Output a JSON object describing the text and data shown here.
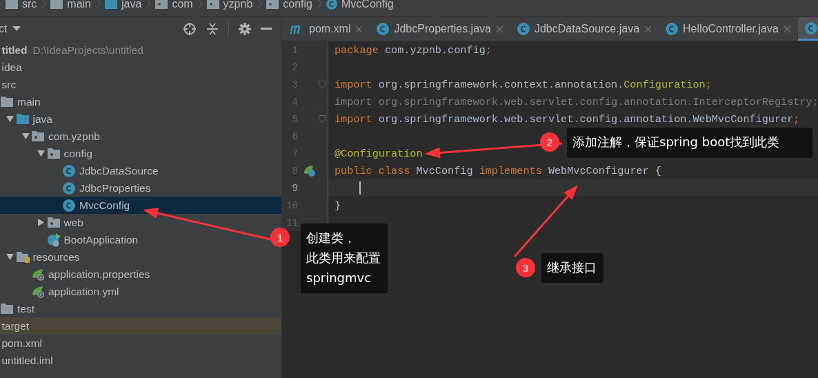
{
  "breadcrumb": [
    {
      "label": "src",
      "kind": "folder"
    },
    {
      "label": "main",
      "kind": "folder"
    },
    {
      "label": "java",
      "kind": "source"
    },
    {
      "label": "com",
      "kind": "package"
    },
    {
      "label": "yzpnb",
      "kind": "package"
    },
    {
      "label": "config",
      "kind": "package"
    },
    {
      "label": "MvcConfig",
      "kind": "class"
    }
  ],
  "project_panel": {
    "title": "ct",
    "tree": [
      {
        "label": "titled",
        "path": "D:\\IdeaProjects\\untitled",
        "kind": "module",
        "selected": false,
        "children": [
          {
            "label": "idea",
            "kind": "folder",
            "selected": false
          },
          {
            "label": "src",
            "kind": "folder",
            "selected": false,
            "children": [
              {
                "label": "main",
                "kind": "folder",
                "selected": false,
                "children": [
                  {
                    "label": "java",
                    "kind": "source",
                    "expanded": true,
                    "selected": false,
                    "children": [
                      {
                        "label": "com.yzpnb",
                        "kind": "package",
                        "expanded": true,
                        "selected": false,
                        "children": [
                          {
                            "label": "config",
                            "kind": "package",
                            "expanded": true,
                            "selected": false,
                            "children": [
                              {
                                "label": "JdbcDataSource",
                                "kind": "class",
                                "selected": false
                              },
                              {
                                "label": "JdbcProperties",
                                "kind": "class",
                                "selected": false
                              },
                              {
                                "label": "MvcConfig",
                                "kind": "class",
                                "selected": true
                              }
                            ]
                          },
                          {
                            "label": "web",
                            "kind": "package",
                            "expanded": false,
                            "selected": false
                          },
                          {
                            "label": "BootApplication",
                            "kind": "boot",
                            "selected": false
                          }
                        ]
                      }
                    ]
                  },
                  {
                    "label": "resources",
                    "kind": "resources",
                    "expanded": true,
                    "selected": false,
                    "children": [
                      {
                        "label": "application.properties",
                        "kind": "spring",
                        "selected": false
                      },
                      {
                        "label": "application.yml",
                        "kind": "spring",
                        "selected": false
                      }
                    ]
                  }
                ]
              },
              {
                "label": "test",
                "kind": "folder",
                "selected": false
              }
            ]
          },
          {
            "label": "target",
            "kind": "excluded",
            "selected": false
          },
          {
            "label": "pom.xml",
            "kind": "maven",
            "selected": false
          },
          {
            "label": "untitled.iml",
            "kind": "iml",
            "selected": false
          }
        ]
      }
    ]
  },
  "tabs": [
    {
      "label": "pom.xml",
      "kind": "maven",
      "selected": false
    },
    {
      "label": "JdbcProperties.java",
      "kind": "class",
      "selected": false
    },
    {
      "label": "JdbcDataSource.java",
      "kind": "class",
      "selected": false
    },
    {
      "label": "HelloController.java",
      "kind": "class",
      "selected": false
    },
    {
      "kind": "class",
      "selected": true
    }
  ],
  "code": [
    {
      "number": "1",
      "current": false,
      "fold": false,
      "marker": false,
      "tokens": [
        {
          "kind": "keyword",
          "text": "package"
        },
        {
          "kind": "plain",
          "text": " com.yzpnb.config"
        },
        {
          "kind": "keyword",
          "text": ";"
        }
      ]
    },
    {
      "number": "2",
      "current": false,
      "fold": false,
      "marker": false
    },
    {
      "number": "3",
      "current": false,
      "fold": true,
      "marker": false,
      "tokens": [
        {
          "kind": "keyword",
          "text": "import"
        },
        {
          "kind": "plain",
          "text": " org.springframework.context.annotation."
        },
        {
          "kind": "annotation",
          "text": "Configuration"
        },
        {
          "kind": "keyword",
          "text": ";"
        }
      ]
    },
    {
      "number": "4",
      "current": false,
      "fold": false,
      "marker": false,
      "tokens": [
        {
          "kind": "unused",
          "text": "import org.springframework.web.servlet.config.annotation.InterceptorRegistry;"
        }
      ]
    },
    {
      "number": "5",
      "current": false,
      "fold": true,
      "marker": false,
      "tokens": [
        {
          "kind": "keyword",
          "text": "import"
        },
        {
          "kind": "plain",
          "text": " org.springframework.web.servlet.config.annotation.WebMvcConfigurer"
        },
        {
          "kind": "keyword",
          "text": ";"
        }
      ]
    },
    {
      "number": "6",
      "current": false,
      "fold": false,
      "marker": false
    },
    {
      "number": "7",
      "current": false,
      "fold": false,
      "marker": false,
      "tokens": [
        {
          "kind": "annotation",
          "text": "@Configuration"
        }
      ]
    },
    {
      "number": "8",
      "current": false,
      "fold": false,
      "marker": true,
      "tokens": [
        {
          "kind": "keyword",
          "text": "public class"
        },
        {
          "kind": "plain",
          "text": " MvcConfig "
        },
        {
          "kind": "keyword",
          "text": "implements"
        },
        {
          "kind": "plain",
          "text": " WebMvcConfigurer {"
        }
      ]
    },
    {
      "number": "9",
      "current": true,
      "fold": false,
      "marker": false
    },
    {
      "number": "10",
      "current": false,
      "fold": false,
      "marker": false,
      "tokens": [
        {
          "kind": "plain",
          "text": "}"
        }
      ]
    },
    {
      "number": "11",
      "current": false,
      "fold": false,
      "marker": false
    }
  ],
  "callouts": [
    {
      "number": "1",
      "lines": [
        "创建类，",
        "此类用来配置",
        "springmvc"
      ]
    },
    {
      "number": "2",
      "lines": [
        "添加注解，保证spring boot找到此类"
      ]
    },
    {
      "number": "3",
      "lines": [
        "继承接口"
      ]
    }
  ]
}
